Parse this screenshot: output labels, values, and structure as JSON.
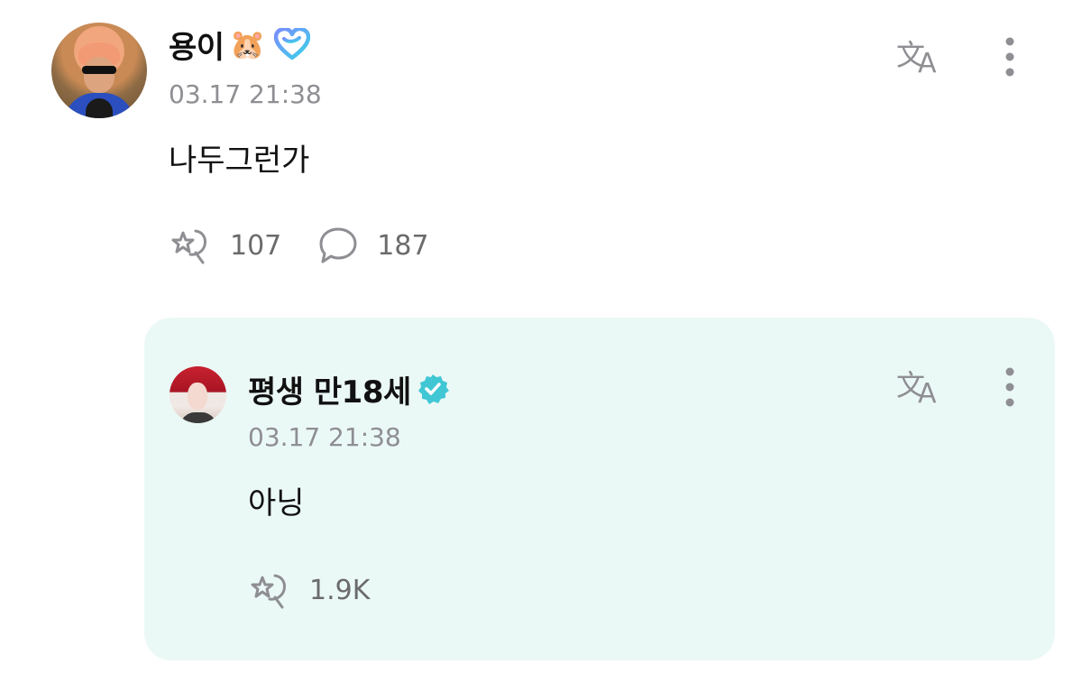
{
  "post": {
    "author": "용이",
    "author_emoji": "🐹",
    "badge_icon": "heart-badge-icon",
    "timestamp": "03.17 21:38",
    "body": "나두그런가",
    "like_count": "107",
    "comment_count": "187"
  },
  "reply": {
    "author": "평생 만18세",
    "badge_icon": "verified-badge-icon",
    "timestamp": "03.17 21:38",
    "body": "아닝",
    "like_count": "1.9K"
  },
  "colors": {
    "reply_background": "#ebf9f6",
    "verified_badge": "#41c7d4",
    "heart_badge_start": "#7b8cff",
    "heart_badge_end": "#3ad1e6",
    "icon_gray": "#8e8e93"
  }
}
